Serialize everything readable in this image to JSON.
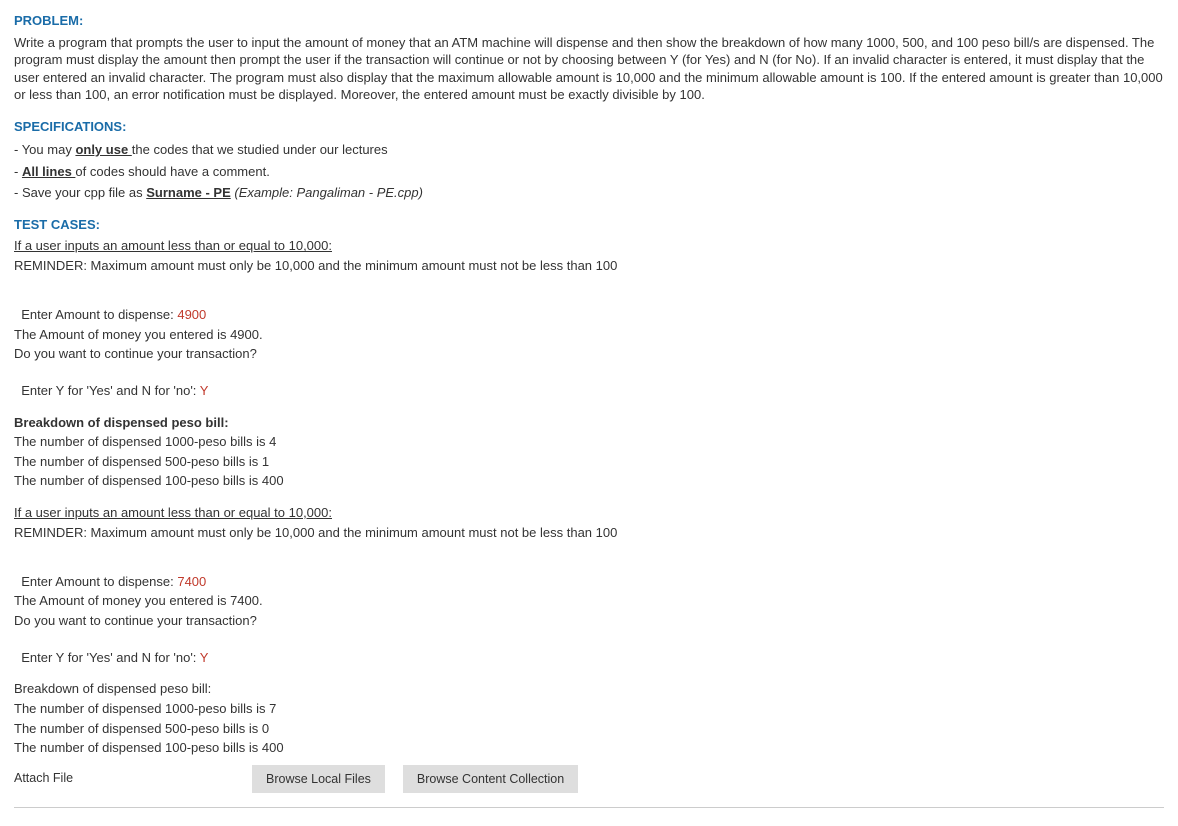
{
  "headings": {
    "problem": "PROBLEM:",
    "specifications": "SPECIFICATIONS:",
    "test_cases": "TEST CASES:"
  },
  "problem_text": "Write a program that prompts the user to input the amount of money that an ATM machine will dispense and then show the breakdown of how many 1000, 500, and 100 peso bill/s are dispensed. The program must display the amount then prompt the user if the transaction will continue or not by choosing between Y (for Yes) and N (for No). If an invalid character is entered, it must display that the user entered an invalid character. The program must also display that the maximum allowable amount is 10,000 and the minimum allowable amount is 100. If the entered amount is greater than 10,000 or less than 100, an error notification must be displayed. Moreover, the entered amount must be exactly divisible by 100.",
  "specs": {
    "item1_pre": "- You may ",
    "item1_ul": "only use ",
    "item1_post": "the codes that we studied under our lectures",
    "item2_pre": "- ",
    "item2_ul": "All lines ",
    "item2_post": "of codes should have a comment.",
    "item3_pre": "- Save your cpp file as ",
    "item3_ul": "Surname - PE",
    "item3_post_italic": " (Example: Pangaliman - PE.cpp)"
  },
  "case1": {
    "heading": "If a user inputs an amount less than or equal to 10,000:",
    "reminder": "REMINDER: Maximum amount must only be 10,000 and the minimum amount must not be less than 100",
    "enter_prefix": "Enter Amount to dispense: ",
    "enter_value": "4900",
    "echo": "The Amount of money you entered is 4900.",
    "continue_q": "Do you want to continue your transaction?",
    "prompt_prefix": "Enter Y for 'Yes' and N for 'no': ",
    "prompt_value": "Y",
    "breakdown_heading": "Breakdown of dispensed peso bill:",
    "b1": "The number of dispensed 1000-peso bills is 4",
    "b2": "The number of dispensed 500-peso bills is 1",
    "b3": "The number of dispensed 100-peso bills is 400"
  },
  "case2": {
    "heading": "If a user inputs an amount less than or equal to 10,000:",
    "reminder": "REMINDER: Maximum amount must only be 10,000 and the minimum amount must not be less than 100",
    "enter_prefix": "Enter Amount to dispense: ",
    "enter_value": "7400",
    "echo": "The Amount of money you entered is 7400.",
    "continue_q": "Do you want to continue your transaction?",
    "prompt_prefix": "Enter Y for 'Yes' and N for 'no': ",
    "prompt_value": "Y",
    "breakdown_heading": "Breakdown of dispensed peso bill:",
    "b1": "The number of dispensed 1000-peso bills is 7",
    "b2": "The number of dispensed 500-peso bills is 0",
    "b3": "The number of dispensed 100-peso bills is 400"
  },
  "attach": {
    "label": "Attach File",
    "browse_local": "Browse Local Files",
    "browse_collection": "Browse Content Collection"
  }
}
